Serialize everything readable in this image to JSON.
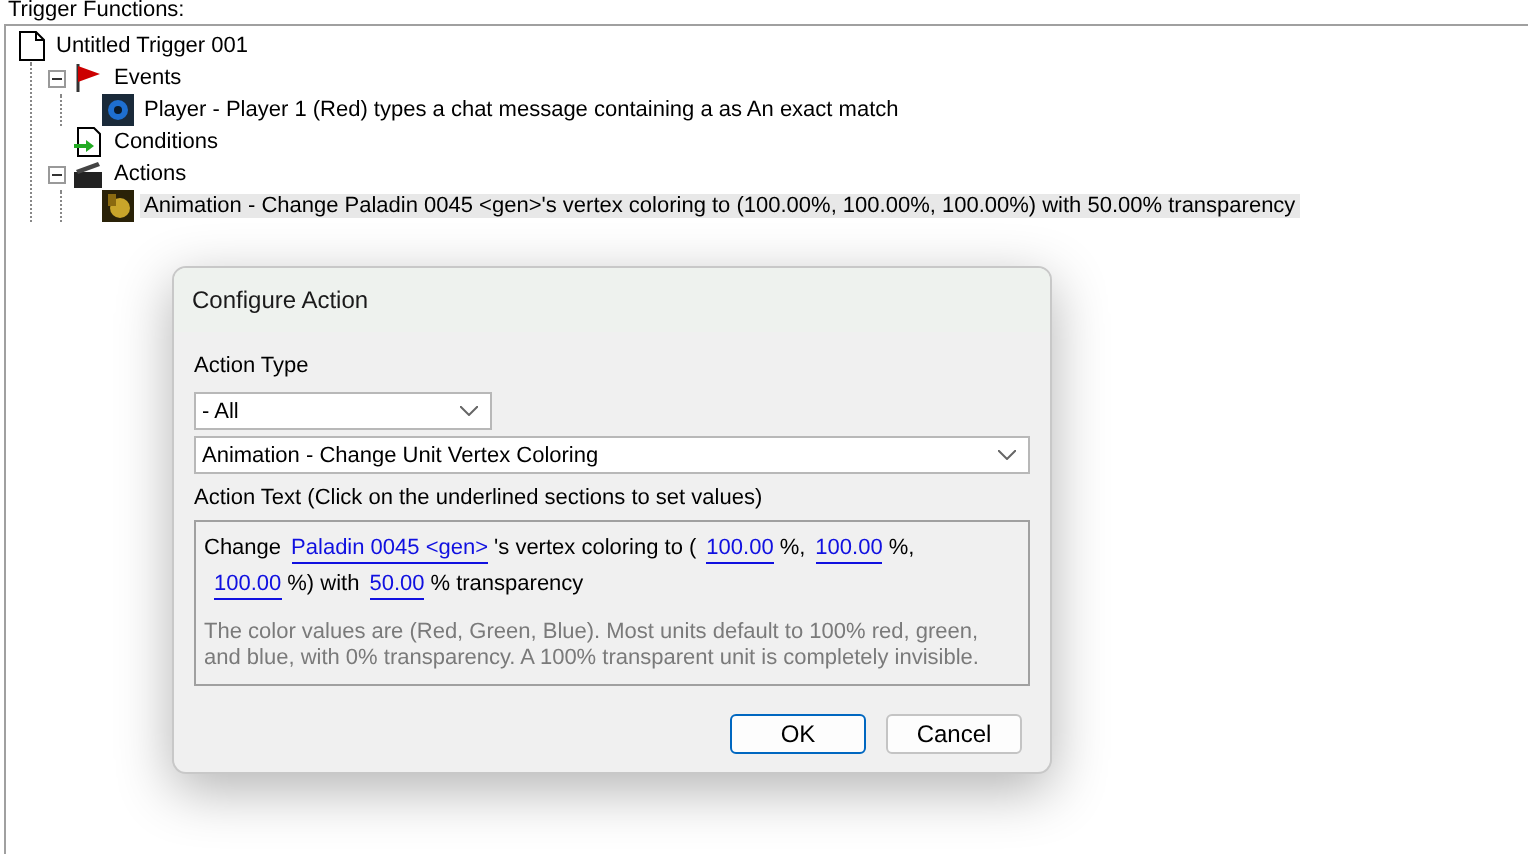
{
  "header": {
    "label": "Trigger Functions:"
  },
  "tree": {
    "label": "Untitled Trigger 001",
    "kind": "trigger",
    "children": [
      {
        "label": "Events",
        "kind": "events",
        "expanded": true,
        "children": [
          {
            "label": "Player - Player 1 (Red) types a chat message containing a as An exact match",
            "kind": "event",
            "selected": false
          }
        ]
      },
      {
        "label": "Conditions",
        "kind": "conditions"
      },
      {
        "label": "Actions",
        "kind": "actions",
        "expanded": true,
        "children": [
          {
            "label": "Animation - Change Paladin 0045 <gen>'s vertex coloring to (100.00%, 100.00%, 100.00%) with 50.00% transparency",
            "kind": "action",
            "selected": true
          }
        ]
      }
    ]
  },
  "dialog": {
    "title": "Configure Action",
    "type_label": "Action Type",
    "type_value": "- All",
    "action_value": "Animation - Change Unit Vertex Coloring",
    "text_label": "Action Text (Click on the underlined sections to set values)",
    "action_text": [
      {
        "kind": "text",
        "text": "Change"
      },
      {
        "kind": "link",
        "text": "Paladin 0045 <gen>"
      },
      {
        "kind": "text",
        "text": "'s vertex coloring to ("
      },
      {
        "kind": "link",
        "text": "100.00"
      },
      {
        "kind": "text",
        "text": "%,"
      },
      {
        "kind": "link",
        "text": "100.00"
      },
      {
        "kind": "text",
        "text": "%,"
      },
      {
        "kind": "link",
        "text": "100.00"
      },
      {
        "kind": "text",
        "text": "%) with"
      },
      {
        "kind": "link",
        "text": "50.00"
      },
      {
        "kind": "text",
        "text": "% transparency"
      }
    ],
    "hint": "The color values are (Red, Green, Blue).  Most units default to 100% red, green, and blue, with 0% transparency.  A 100% transparent unit is completely invisible.",
    "buttons": [
      {
        "label": "OK",
        "kind": "default"
      },
      {
        "label": "Cancel",
        "kind": "normal"
      }
    ]
  }
}
